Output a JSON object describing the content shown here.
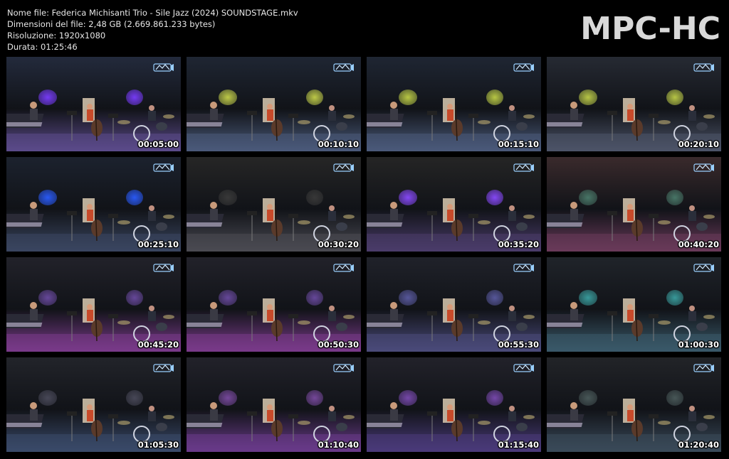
{
  "info": {
    "filename": "Nome file: Federica Michisanti Trio - Sile Jazz (2024) SOUNDSTAGE.mkv",
    "filesize": "Dimensioni del file: 2,48 GB (2.669.861.233 bytes)",
    "resolution": "Risoluzione: 1920x1080",
    "duration": "Durata: 01:25:46"
  },
  "logo": "MPC-HC",
  "thumbnails": [
    {
      "time": "00:05:00",
      "bg": "#232a3c",
      "floor": "#5b4a8a",
      "light": "#7a3cff",
      "light2": "#6a38e8"
    },
    {
      "time": "00:10:10",
      "bg": "#1f2633",
      "floor": "#4a5a7a",
      "light": "#c6d24a",
      "light2": "#c6d24a"
    },
    {
      "time": "00:15:10",
      "bg": "#1f2633",
      "floor": "#4a5a7a",
      "light": "#c0d046",
      "light2": "#c0d046"
    },
    {
      "time": "00:20:10",
      "bg": "#262a33",
      "floor": "#4c5468",
      "light": "#bfce48",
      "light2": "#bfce48"
    },
    {
      "time": "00:25:10",
      "bg": "#1c222e",
      "floor": "#3a4660",
      "light": "#2a5cff",
      "light2": "#2a5cff"
    },
    {
      "time": "00:30:20",
      "bg": "#262626",
      "floor": "#4a4a52",
      "light": "#3a3a3a",
      "light2": "#3a3a3a"
    },
    {
      "time": "00:35:20",
      "bg": "#252525",
      "floor": "#4a3c6a",
      "light": "#8a4aff",
      "light2": "#8a4aff"
    },
    {
      "time": "00:40:20",
      "bg": "#3a2a2c",
      "floor": "#6a3a5a",
      "light": "#4a7a6a",
      "light2": "#4a7a6a"
    },
    {
      "time": "00:45:20",
      "bg": "#22222a",
      "floor": "#7a3a8a",
      "light": "#6a4aa0",
      "light2": "#6a4aa0"
    },
    {
      "time": "00:50:30",
      "bg": "#22222a",
      "floor": "#7a3a8a",
      "light": "#6a4aa0",
      "light2": "#6a4aa0"
    },
    {
      "time": "00:55:30",
      "bg": "#20222a",
      "floor": "#4a4a7a",
      "light": "#5a5aa0",
      "light2": "#5a5aa0"
    },
    {
      "time": "01:00:30",
      "bg": "#20242a",
      "floor": "#3a5a6a",
      "light": "#3aa0a0",
      "light2": "#3aa0a0"
    },
    {
      "time": "01:05:30",
      "bg": "#22242a",
      "floor": "#3a4a6a",
      "light": "#4a4a5a",
      "light2": "#4a4a5a"
    },
    {
      "time": "01:10:40",
      "bg": "#22222a",
      "floor": "#6a3a8a",
      "light": "#7a4aa0",
      "light2": "#7a4aa0"
    },
    {
      "time": "01:15:40",
      "bg": "#22222a",
      "floor": "#4a3a7a",
      "light": "#7a4ab0",
      "light2": "#7a4ab0"
    },
    {
      "time": "01:20:40",
      "bg": "#222428",
      "floor": "#3a4a5a",
      "light": "#4a5a5a",
      "light2": "#4a5a5a"
    }
  ]
}
